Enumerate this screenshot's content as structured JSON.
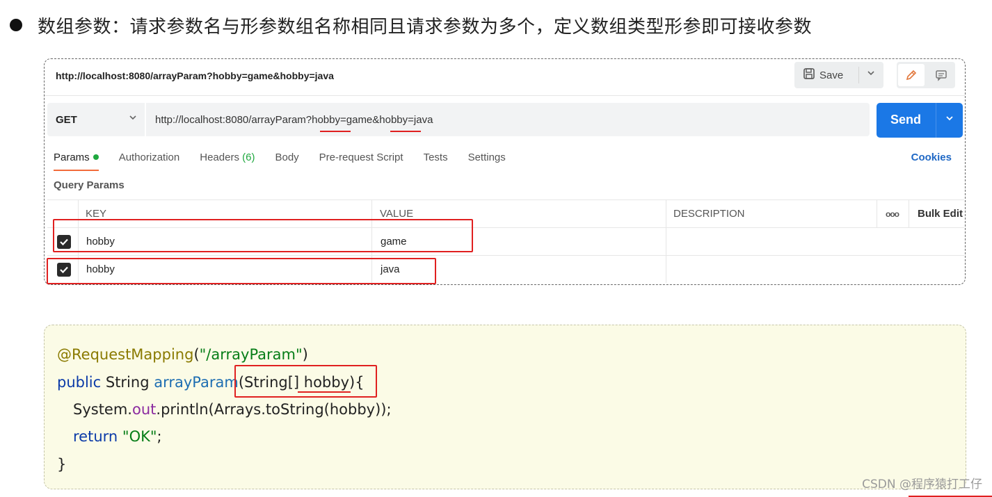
{
  "heading": "数组参数：请求参数名与形参数组名称相同且请求参数为多个，定义数组类型形参即可接收参数",
  "postman": {
    "title": "http://localhost:8080/arrayParam?hobby=game&hobby=java",
    "save_label": "Save",
    "method": "GET",
    "url": "http://localhost:8080/arrayParam?hobby=game&hobby=java",
    "send_label": "Send",
    "tabs": {
      "params": "Params",
      "authorization": "Authorization",
      "headers": "Headers",
      "headers_count": "(6)",
      "body": "Body",
      "prerequest": "Pre-request Script",
      "tests": "Tests",
      "settings": "Settings"
    },
    "cookies": "Cookies",
    "query_params_label": "Query Params",
    "columns": {
      "key": "KEY",
      "value": "VALUE",
      "description": "DESCRIPTION",
      "more": "ooo",
      "bulk_edit": "Bulk Edit"
    },
    "rows": [
      {
        "key": "hobby",
        "value": "game",
        "checked": true
      },
      {
        "key": "hobby",
        "value": "java",
        "checked": true
      }
    ]
  },
  "code": {
    "l1_anno": "@RequestMapping",
    "l1_p1": "(",
    "l1_str": "\"/arrayParam\"",
    "l1_p2": ")",
    "l2_kw": "public",
    "l2_type": " String ",
    "l2_fn": "arrayParam",
    "l2_params": "(String[] hobby){",
    "l3_a": "System.",
    "l3_fld": "out",
    "l3_b": ".println(Arrays.toString(hobby));",
    "l4_kw": "return",
    "l4_sp": " ",
    "l4_str": "\"OK\"",
    "l4_end": ";",
    "l5": "}"
  },
  "watermark": "CSDN @程序猿打工仔",
  "colors": {
    "send": "#1b78e6",
    "highlight": "#e02020",
    "active_tab": "#f26b3a",
    "params_dot": "#1fa83f",
    "code_bg": "#fbfbe6"
  }
}
